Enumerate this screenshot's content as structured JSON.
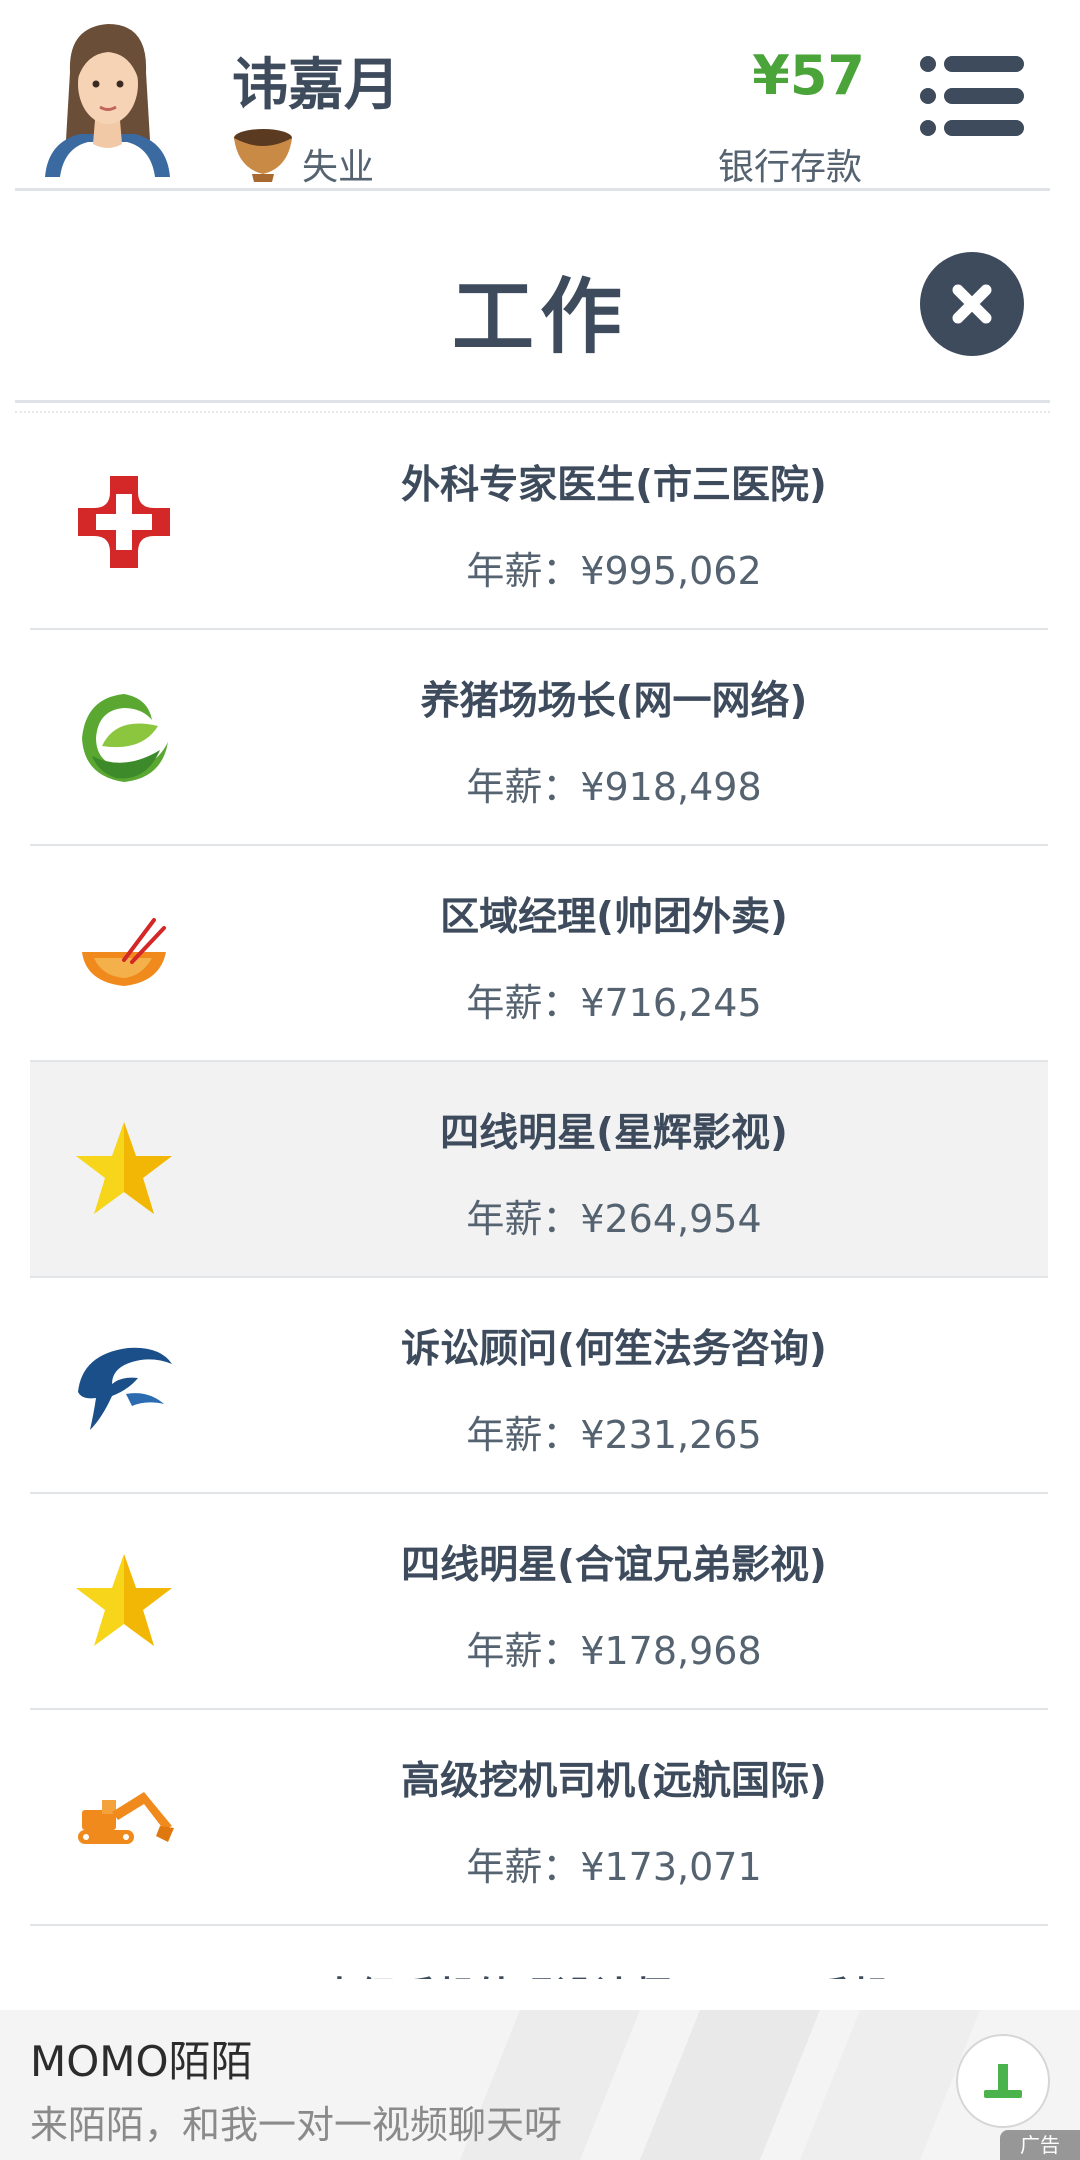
{
  "header": {
    "name": "讳嘉月",
    "status": "失业",
    "money": "¥57",
    "bank_label": "银行存款"
  },
  "title": "工作",
  "jobs": [
    {
      "title": "外科专家医生(市三医院)",
      "salary": "年薪：¥995,062",
      "icon": "red-cross-icon"
    },
    {
      "title": "养猪场场长(网一网络)",
      "salary": "年薪：¥918,498",
      "icon": "green-leaf-logo-icon"
    },
    {
      "title": "区域经理(帅团外卖)",
      "salary": "年薪：¥716,245",
      "icon": "bowl-chopsticks-icon"
    },
    {
      "title": "四线明星(星辉影视)",
      "salary": "年薪：¥264,954",
      "icon": "star-icon"
    },
    {
      "title": "诉讼顾问(何笙法务咨询)",
      "salary": "年薪：¥231,265",
      "icon": "dolphin-logo-icon"
    },
    {
      "title": "四线明星(合谊兄弟影视)",
      "salary": "年薪：¥178,968",
      "icon": "star-icon"
    },
    {
      "title": "高级挖机司机(远航国际)",
      "salary": "年薪：¥173,071",
      "icon": "excavator-icon"
    },
    {
      "title": "中级手机外观设计师(OPPO手机)",
      "salary": "",
      "icon": ""
    }
  ],
  "ad": {
    "title": "MOMO陌陌",
    "subtitle": "来陌陌，和我一对一视频聊天呀",
    "tag": "广告"
  },
  "colors": {
    "primary": "#3d4b5c",
    "money": "#4aa43a",
    "divider": "#dfe3e7",
    "selected_row": "#f2f2f2"
  }
}
